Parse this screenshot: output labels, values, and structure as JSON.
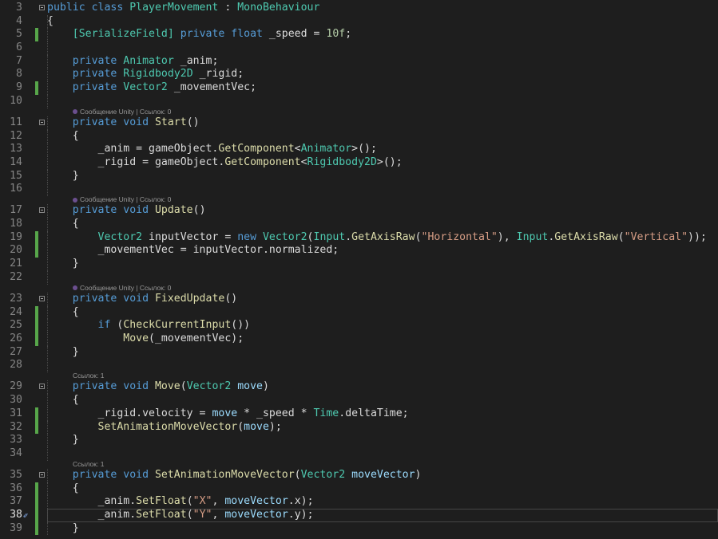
{
  "editor": {
    "colors": {
      "background": "#1e1e1e",
      "keyword": "#569cd6",
      "type": "#4ec9b0",
      "method": "#dcdcaa",
      "string": "#d69d85",
      "number": "#b5cea8",
      "change_marker": "#57a64a"
    },
    "current_line": 38,
    "lines": [
      {
        "n": 3,
        "fold": true,
        "t": [
          [
            "kw",
            "public class "
          ],
          [
            "ty",
            "PlayerMovement"
          ],
          [
            "pl",
            " : "
          ],
          [
            "ty",
            "MonoBehaviour"
          ]
        ]
      },
      {
        "n": 4,
        "t": [
          [
            "pl",
            "{"
          ]
        ]
      },
      {
        "n": 5,
        "chg": true,
        "t": [
          [
            "pl",
            "    "
          ],
          [
            "ty",
            "[SerializeField]"
          ],
          [
            "pl",
            " "
          ],
          [
            "kw",
            "private float "
          ],
          [
            "pl",
            "_speed = "
          ],
          [
            "nu",
            "10f"
          ],
          [
            "pl",
            ";"
          ]
        ]
      },
      {
        "n": 6,
        "t": []
      },
      {
        "n": 7,
        "t": [
          [
            "pl",
            "    "
          ],
          [
            "kw",
            "private "
          ],
          [
            "ty",
            "Animator"
          ],
          [
            "pl",
            " _anim;"
          ]
        ]
      },
      {
        "n": 8,
        "t": [
          [
            "pl",
            "    "
          ],
          [
            "kw",
            "private "
          ],
          [
            "ty",
            "Rigidbody2D"
          ],
          [
            "pl",
            " _rigid;"
          ]
        ]
      },
      {
        "n": 9,
        "chg": true,
        "t": [
          [
            "pl",
            "    "
          ],
          [
            "kw",
            "private "
          ],
          [
            "ty",
            "Vector2"
          ],
          [
            "pl",
            " _movementVec;"
          ]
        ]
      },
      {
        "n": 10,
        "t": []
      },
      {
        "lens": "Сообщение Unity | Ссылок: 0",
        "unity": true
      },
      {
        "n": 11,
        "fold": true,
        "t": [
          [
            "pl",
            "    "
          ],
          [
            "kw",
            "private void "
          ],
          [
            "fn",
            "Start"
          ],
          [
            "pl",
            "()"
          ]
        ]
      },
      {
        "n": 12,
        "t": [
          [
            "pl",
            "    {"
          ]
        ]
      },
      {
        "n": 13,
        "t": [
          [
            "pl",
            "        _anim = gameObject."
          ],
          [
            "fn",
            "GetComponent"
          ],
          [
            "pl",
            "<"
          ],
          [
            "ty",
            "Animator"
          ],
          [
            "pl",
            ">();"
          ]
        ]
      },
      {
        "n": 14,
        "t": [
          [
            "pl",
            "        _rigid = gameObject."
          ],
          [
            "fn",
            "GetComponent"
          ],
          [
            "pl",
            "<"
          ],
          [
            "ty",
            "Rigidbody2D"
          ],
          [
            "pl",
            ">();"
          ]
        ]
      },
      {
        "n": 15,
        "t": [
          [
            "pl",
            "    }"
          ]
        ]
      },
      {
        "n": 16,
        "t": []
      },
      {
        "lens": "Сообщение Unity | Ссылок: 0",
        "unity": true
      },
      {
        "n": 17,
        "fold": true,
        "t": [
          [
            "pl",
            "    "
          ],
          [
            "kw",
            "private void "
          ],
          [
            "fn",
            "Update"
          ],
          [
            "pl",
            "()"
          ]
        ]
      },
      {
        "n": 18,
        "t": [
          [
            "pl",
            "    {"
          ]
        ]
      },
      {
        "n": 19,
        "chg": true,
        "t": [
          [
            "pl",
            "        "
          ],
          [
            "ty",
            "Vector2"
          ],
          [
            "pl",
            " inputVector = "
          ],
          [
            "kw",
            "new "
          ],
          [
            "ty",
            "Vector2"
          ],
          [
            "pl",
            "("
          ],
          [
            "ty",
            "Input"
          ],
          [
            "pl",
            "."
          ],
          [
            "fn",
            "GetAxisRaw"
          ],
          [
            "pl",
            "("
          ],
          [
            "st",
            "\"Horizontal\""
          ],
          [
            "pl",
            "), "
          ],
          [
            "ty",
            "Input"
          ],
          [
            "pl",
            "."
          ],
          [
            "fn",
            "GetAxisRaw"
          ],
          [
            "pl",
            "("
          ],
          [
            "st",
            "\"Vertical\""
          ],
          [
            "pl",
            "));"
          ]
        ]
      },
      {
        "n": 20,
        "chg": true,
        "t": [
          [
            "pl",
            "        _movementVec = inputVector.normalized;"
          ]
        ]
      },
      {
        "n": 21,
        "t": [
          [
            "pl",
            "    }"
          ]
        ]
      },
      {
        "n": 22,
        "t": []
      },
      {
        "lens": "Сообщение Unity | Ссылок: 0",
        "unity": true
      },
      {
        "n": 23,
        "fold": true,
        "t": [
          [
            "pl",
            "    "
          ],
          [
            "kw",
            "private void "
          ],
          [
            "fn",
            "FixedUpdate"
          ],
          [
            "pl",
            "()"
          ]
        ]
      },
      {
        "n": 24,
        "chg": true,
        "t": [
          [
            "pl",
            "    {"
          ]
        ]
      },
      {
        "n": 25,
        "chg": true,
        "t": [
          [
            "pl",
            "        "
          ],
          [
            "kw",
            "if "
          ],
          [
            "pl",
            "("
          ],
          [
            "fn",
            "CheckCurrentInput"
          ],
          [
            "pl",
            "())"
          ]
        ]
      },
      {
        "n": 26,
        "chg": true,
        "t": [
          [
            "pl",
            "            "
          ],
          [
            "fn",
            "Move"
          ],
          [
            "pl",
            "(_movementVec);"
          ]
        ]
      },
      {
        "n": 27,
        "t": [
          [
            "pl",
            "    }"
          ]
        ]
      },
      {
        "n": 28,
        "t": []
      },
      {
        "lens": "Ссылок: 1"
      },
      {
        "n": 29,
        "fold": true,
        "t": [
          [
            "pl",
            "    "
          ],
          [
            "kw",
            "private void "
          ],
          [
            "fn",
            "Move"
          ],
          [
            "pl",
            "("
          ],
          [
            "ty",
            "Vector2"
          ],
          [
            "pa",
            " move"
          ],
          [
            "pl",
            ")"
          ]
        ]
      },
      {
        "n": 30,
        "t": [
          [
            "pl",
            "    {"
          ]
        ]
      },
      {
        "n": 31,
        "chg": true,
        "t": [
          [
            "pl",
            "        _rigid.velocity = "
          ],
          [
            "pa",
            "move"
          ],
          [
            "pl",
            " * _speed * "
          ],
          [
            "ty",
            "Time"
          ],
          [
            "pl",
            ".deltaTime;"
          ]
        ]
      },
      {
        "n": 32,
        "chg": true,
        "t": [
          [
            "pl",
            "        "
          ],
          [
            "fn",
            "SetAnimationMoveVector"
          ],
          [
            "pl",
            "("
          ],
          [
            "pa",
            "move"
          ],
          [
            "pl",
            ");"
          ]
        ]
      },
      {
        "n": 33,
        "t": [
          [
            "pl",
            "    }"
          ]
        ]
      },
      {
        "n": 34,
        "t": []
      },
      {
        "lens": "Ссылок: 1"
      },
      {
        "n": 35,
        "fold": true,
        "t": [
          [
            "pl",
            "    "
          ],
          [
            "kw",
            "private void "
          ],
          [
            "fn",
            "SetAnimationMoveVector"
          ],
          [
            "pl",
            "("
          ],
          [
            "ty",
            "Vector2"
          ],
          [
            "pa",
            " moveVector"
          ],
          [
            "pl",
            ")"
          ]
        ]
      },
      {
        "n": 36,
        "chg": true,
        "t": [
          [
            "pl",
            "    {"
          ]
        ]
      },
      {
        "n": 37,
        "chg": true,
        "t": [
          [
            "pl",
            "        _anim."
          ],
          [
            "fn",
            "SetFloat"
          ],
          [
            "pl",
            "("
          ],
          [
            "st",
            "\"X\""
          ],
          [
            "pl",
            ", "
          ],
          [
            "pa",
            "moveVector"
          ],
          [
            "pl",
            ".x);"
          ]
        ]
      },
      {
        "n": 38,
        "chg": true,
        "t": [
          [
            "pl",
            "        _anim."
          ],
          [
            "fn",
            "SetFloat"
          ],
          [
            "pl",
            "("
          ],
          [
            "st",
            "\"Y\""
          ],
          [
            "pl",
            ", "
          ],
          [
            "pa",
            "moveVector"
          ],
          [
            "pl",
            ".y);"
          ]
        ]
      },
      {
        "n": 39,
        "chg": true,
        "t": [
          [
            "pl",
            "    }"
          ]
        ]
      }
    ]
  }
}
